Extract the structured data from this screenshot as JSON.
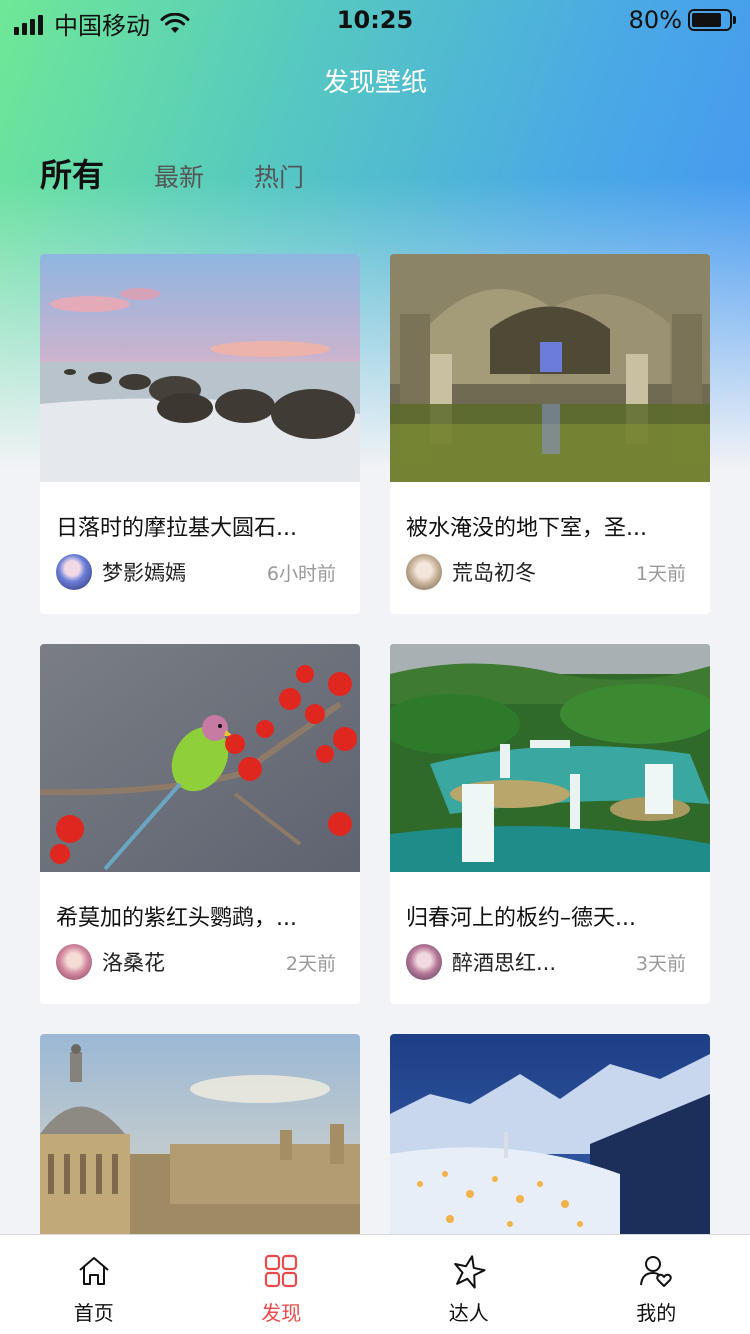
{
  "status_bar": {
    "carrier": "中国移动",
    "time": "10:25",
    "battery": "80%"
  },
  "header": {
    "title": "发现壁纸"
  },
  "tabs": [
    {
      "label": "所有",
      "active": true
    },
    {
      "label": "最新",
      "active": false
    },
    {
      "label": "热门",
      "active": false
    }
  ],
  "cards": [
    {
      "title": "日落时的摩拉基大圆石...",
      "author": "梦影嫣嫣",
      "time": "6小时前"
    },
    {
      "title": "被水淹没的地下室，圣...",
      "author": "荒岛初冬",
      "time": "1天前"
    },
    {
      "title": "希莫加的紫红头鹦鹉，...",
      "author": "洛桑花",
      "time": "2天前"
    },
    {
      "title": "归春河上的板约–德天...",
      "author": "醉酒思红...",
      "time": "3天前"
    },
    {
      "title": "",
      "author": "",
      "time": ""
    },
    {
      "title": "",
      "author": "",
      "time": ""
    }
  ],
  "bottom_nav": [
    {
      "label": "首页",
      "icon": "home-icon",
      "active": false
    },
    {
      "label": "发现",
      "icon": "grid-icon",
      "active": true
    },
    {
      "label": "达人",
      "icon": "star-icon",
      "active": false
    },
    {
      "label": "我的",
      "icon": "profile-icon",
      "active": false
    }
  ],
  "colors": {
    "accent": "#e94b4b",
    "gradient_start": "#6fe896",
    "gradient_end": "#4494f4"
  }
}
